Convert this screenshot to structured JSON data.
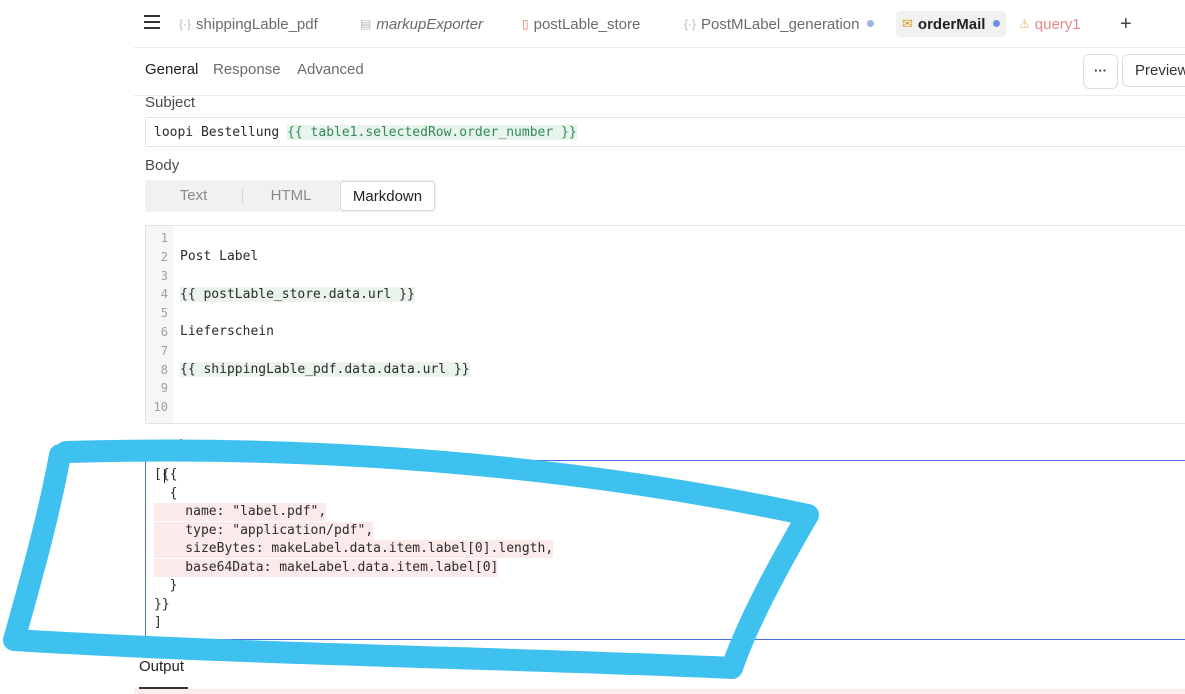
{
  "tabs": [
    {
      "label": "shippingLable_pdf",
      "icon": "braces-icon"
    },
    {
      "label": "markupExporter",
      "icon": "document-icon"
    },
    {
      "label": "postLable_store",
      "icon": "file-icon"
    },
    {
      "label": "PostMLabel_generation",
      "icon": "braces-icon"
    },
    {
      "label": "orderMail",
      "icon": "mail-icon"
    },
    {
      "label": "query1",
      "icon": "warning-icon"
    }
  ],
  "subtabs": {
    "general": "General",
    "response": "Response",
    "advanced": "Advanced"
  },
  "toolbar": {
    "more": "···",
    "preview": "Preview"
  },
  "subject": {
    "label": "Subject",
    "prefix": "loopi Bestellung ",
    "template": "{{ table1.selectedRow.order_number }}"
  },
  "body": {
    "label": "Body",
    "modes": [
      "Text",
      "HTML",
      "Markdown"
    ],
    "lines": [
      "",
      "Post Label",
      "",
      "{{ postLable_store.data.url }}",
      "",
      "Lieferschein",
      "",
      "{{ shippingLable_pdf.data.data.url }}",
      "",
      ""
    ],
    "line_numbers": [
      "1",
      "2",
      "3",
      "4",
      "5",
      "6",
      "7",
      "8",
      "9",
      "10"
    ]
  },
  "attachment": {
    "label": "Attachment",
    "lines": [
      "[{{",
      "  {",
      "    name: \"label.pdf\",",
      "    type: \"application/pdf\",",
      "    sizeBytes: makeLabel.data.item.label[0].length,",
      "    base64Data: makeLabel.data.item.label[0]",
      "  }",
      "}}",
      "]"
    ]
  },
  "output": {
    "label": "Output"
  },
  "colors": {
    "annotation": "#3fc1ef",
    "accent_blue": "#4a5bd0",
    "template_green": "#2f8a55"
  }
}
